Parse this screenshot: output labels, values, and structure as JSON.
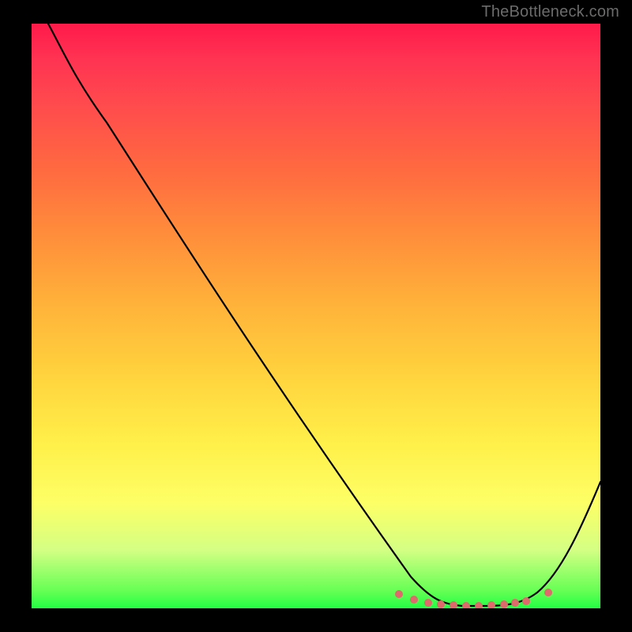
{
  "watermark": "TheBottleneck.com",
  "chart_data": {
    "type": "line",
    "title": "",
    "xlabel": "",
    "ylabel": "",
    "xlim": [
      0,
      100
    ],
    "ylim": [
      0,
      100
    ],
    "series": [
      {
        "name": "curve",
        "x": [
          3,
          8,
          15,
          30,
          50,
          65,
          72,
          75,
          78,
          82,
          85,
          88,
          92,
          96,
          100
        ],
        "y": [
          100,
          93,
          82,
          60,
          30,
          8,
          1,
          0.5,
          0.4,
          0.4,
          0.5,
          0.8,
          4,
          12,
          22
        ]
      }
    ],
    "markers": {
      "name": "highlight-points",
      "color": "#dd6b6b",
      "x": [
        64,
        67,
        70,
        72,
        74,
        76,
        78,
        80,
        82,
        84,
        87,
        91
      ],
      "y": [
        1.6,
        1.0,
        0.7,
        0.5,
        0.4,
        0.4,
        0.4,
        0.4,
        0.4,
        0.5,
        0.6,
        1.4
      ]
    },
    "gradient_stops": [
      {
        "pos": 0,
        "color": "#ff1a4a"
      },
      {
        "pos": 25,
        "color": "#ff6a40"
      },
      {
        "pos": 50,
        "color": "#ffb23a"
      },
      {
        "pos": 75,
        "color": "#fff04a"
      },
      {
        "pos": 95,
        "color": "#66ff55"
      },
      {
        "pos": 100,
        "color": "#22ff44"
      }
    ]
  }
}
